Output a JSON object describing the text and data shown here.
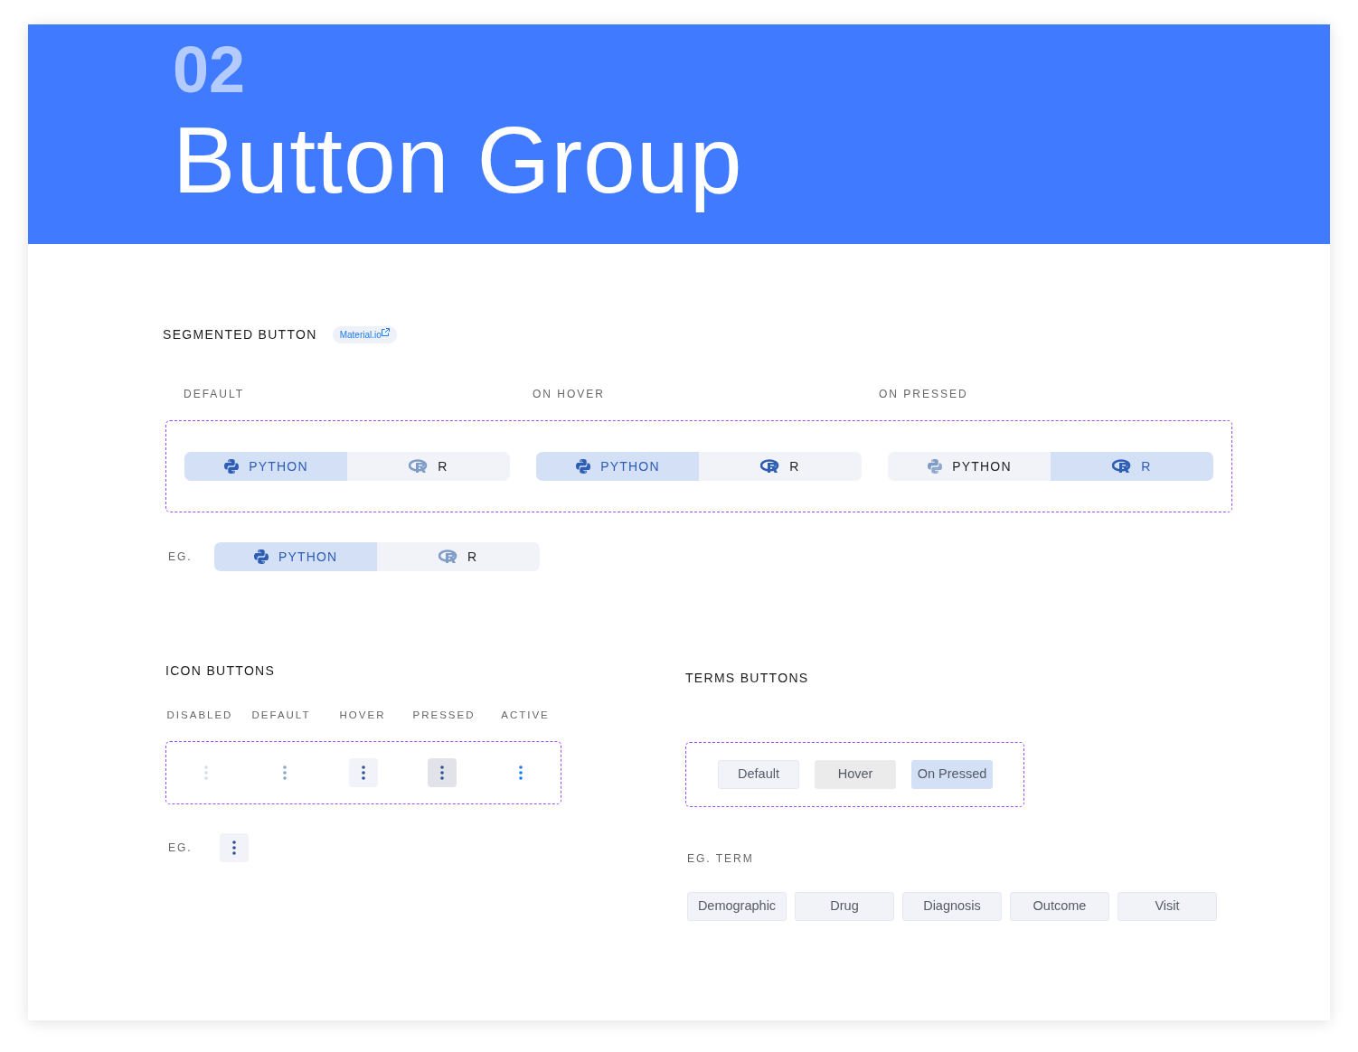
{
  "header": {
    "number": "02",
    "title": "Button Group"
  },
  "segmented": {
    "title": "SEGMENTED BUTTON",
    "link": "Material.io",
    "states": [
      {
        "label": "DEFAULT",
        "segments": [
          {
            "label": "PYTHON",
            "kind": "python",
            "selected": true,
            "hovered": false
          },
          {
            "label": "R",
            "kind": "r",
            "selected": false,
            "hovered": false
          }
        ]
      },
      {
        "label": "ON HOVER",
        "segments": [
          {
            "label": "PYTHON",
            "kind": "python",
            "selected": true,
            "hovered": false
          },
          {
            "label": "R",
            "kind": "r",
            "selected": false,
            "hovered": true
          }
        ]
      },
      {
        "label": "ON PRESSED",
        "segments": [
          {
            "label": "PYTHON",
            "kind": "python",
            "selected": false,
            "hovered": false
          },
          {
            "label": "R",
            "kind": "r",
            "selected": true,
            "hovered": false
          }
        ]
      }
    ],
    "example": {
      "label": "EG.",
      "segments": [
        {
          "label": "PYTHON",
          "kind": "python",
          "selected": true,
          "hovered": false
        },
        {
          "label": "R",
          "kind": "r",
          "selected": false,
          "hovered": false
        }
      ]
    }
  },
  "icon_buttons": {
    "title": "ICON BUTTONS",
    "states": [
      {
        "label": "DISABLED",
        "kind": "disabled"
      },
      {
        "label": "DEFAULT",
        "kind": "default"
      },
      {
        "label": "HOVER",
        "kind": "hover"
      },
      {
        "label": "PRESSED",
        "kind": "pressed"
      },
      {
        "label": "ACTIVE",
        "kind": "active"
      }
    ],
    "example": {
      "label": "EG.",
      "kind": "hover"
    }
  },
  "terms_buttons": {
    "title": "TERMS BUTTONS",
    "states": [
      {
        "label": "Default",
        "kind": "default"
      },
      {
        "label": "Hover",
        "kind": "hover"
      },
      {
        "label": "On Pressed",
        "kind": "pressed"
      }
    ],
    "example_label": "EG. TERM",
    "terms": [
      {
        "label": "Demographic"
      },
      {
        "label": "Drug"
      },
      {
        "label": "Diagnosis"
      },
      {
        "label": "Outcome"
      },
      {
        "label": "Visit"
      }
    ]
  }
}
